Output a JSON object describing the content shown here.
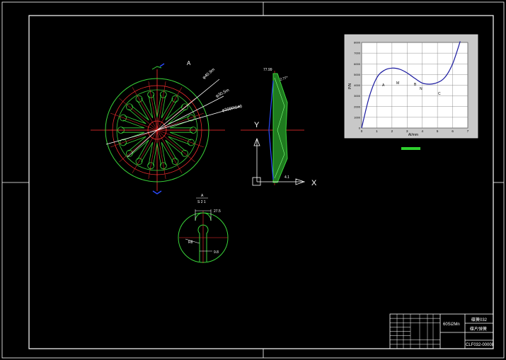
{
  "drawing": {
    "dimensions": {
      "d1": "φ40.9m",
      "d2": "φ30.5m",
      "d3": "φ309RS40",
      "arrow_label": "A"
    },
    "section": {
      "label_top": "A",
      "label_bottom": "S 2 1",
      "dim_top": "27.5",
      "dim_left": "R8",
      "dim_bottom": "9.8"
    },
    "profile": {
      "top_label": "77.99",
      "angle": "2.77°",
      "bottom_label": "4.1",
      "axis_x": "X",
      "axis_y": "Y"
    }
  },
  "chart_data": {
    "type": "line",
    "x": [
      0,
      0.5,
      1,
      1.5,
      2,
      2.5,
      3,
      3.5,
      4,
      4.5,
      5,
      5.5,
      6,
      6.5
    ],
    "series": [
      {
        "values": [
          0,
          2900,
          4700,
          5400,
          5600,
          5500,
          5150,
          4650,
          4200,
          4100,
          4250,
          4750,
          6000,
          8100
        ]
      }
    ],
    "xlabel": "Al/mm",
    "ylabel": "P/N",
    "xlim": [
      0,
      7
    ],
    "ylim": [
      0,
      8000
    ],
    "xticks": [
      "0",
      "1",
      "2",
      "3",
      "4",
      "5",
      "6",
      "7"
    ],
    "yticks": [
      "0",
      "1000",
      "2000",
      "3000",
      "4000",
      "5000",
      "6000",
      "7000",
      "8000"
    ],
    "annotations": [
      "A",
      "M",
      "B",
      "N",
      "C"
    ],
    "grid": true
  },
  "title_block": {
    "material": "60Si2Mn",
    "drawing_name": "碟簧032",
    "part_name": "碟片弹簧",
    "number": "CLF032-00008"
  }
}
